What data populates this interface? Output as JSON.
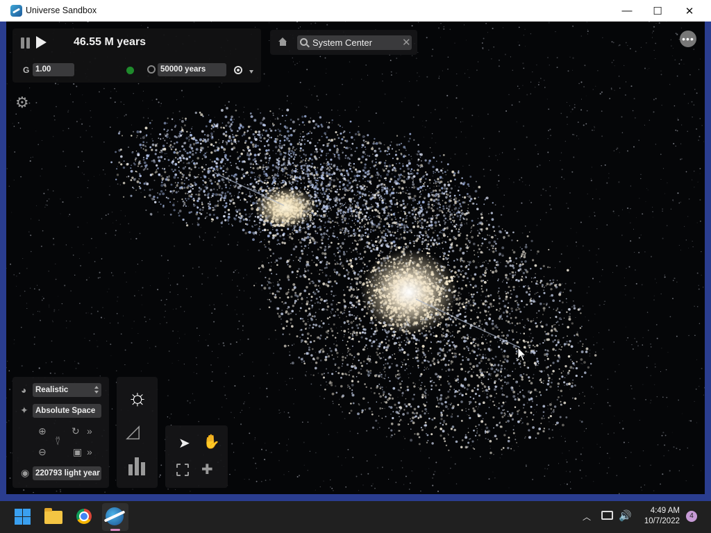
{
  "window": {
    "title": "Universe Sandbox",
    "minimize_glyph": "—",
    "maximize_glyph": "☐",
    "close_glyph": "✕"
  },
  "simulation": {
    "time": "46.55 M years",
    "g_label": "G",
    "g_value": "1.00",
    "time_step": "50000 years",
    "status_color": "#1f8a2c"
  },
  "search": {
    "value": "System Center",
    "clear_glyph": "✕"
  },
  "more_glyph": "•••",
  "view": {
    "render_mode": "Realistic",
    "frame": "Absolute Space",
    "distance": "220793 light year"
  },
  "taskbar": {
    "time": "4:49 AM",
    "date": "10/7/2022",
    "notification_count": "4"
  },
  "colors": {
    "accent": "#2a3d8f",
    "panel": "#1c1c1e",
    "field": "#3a3a3c"
  }
}
